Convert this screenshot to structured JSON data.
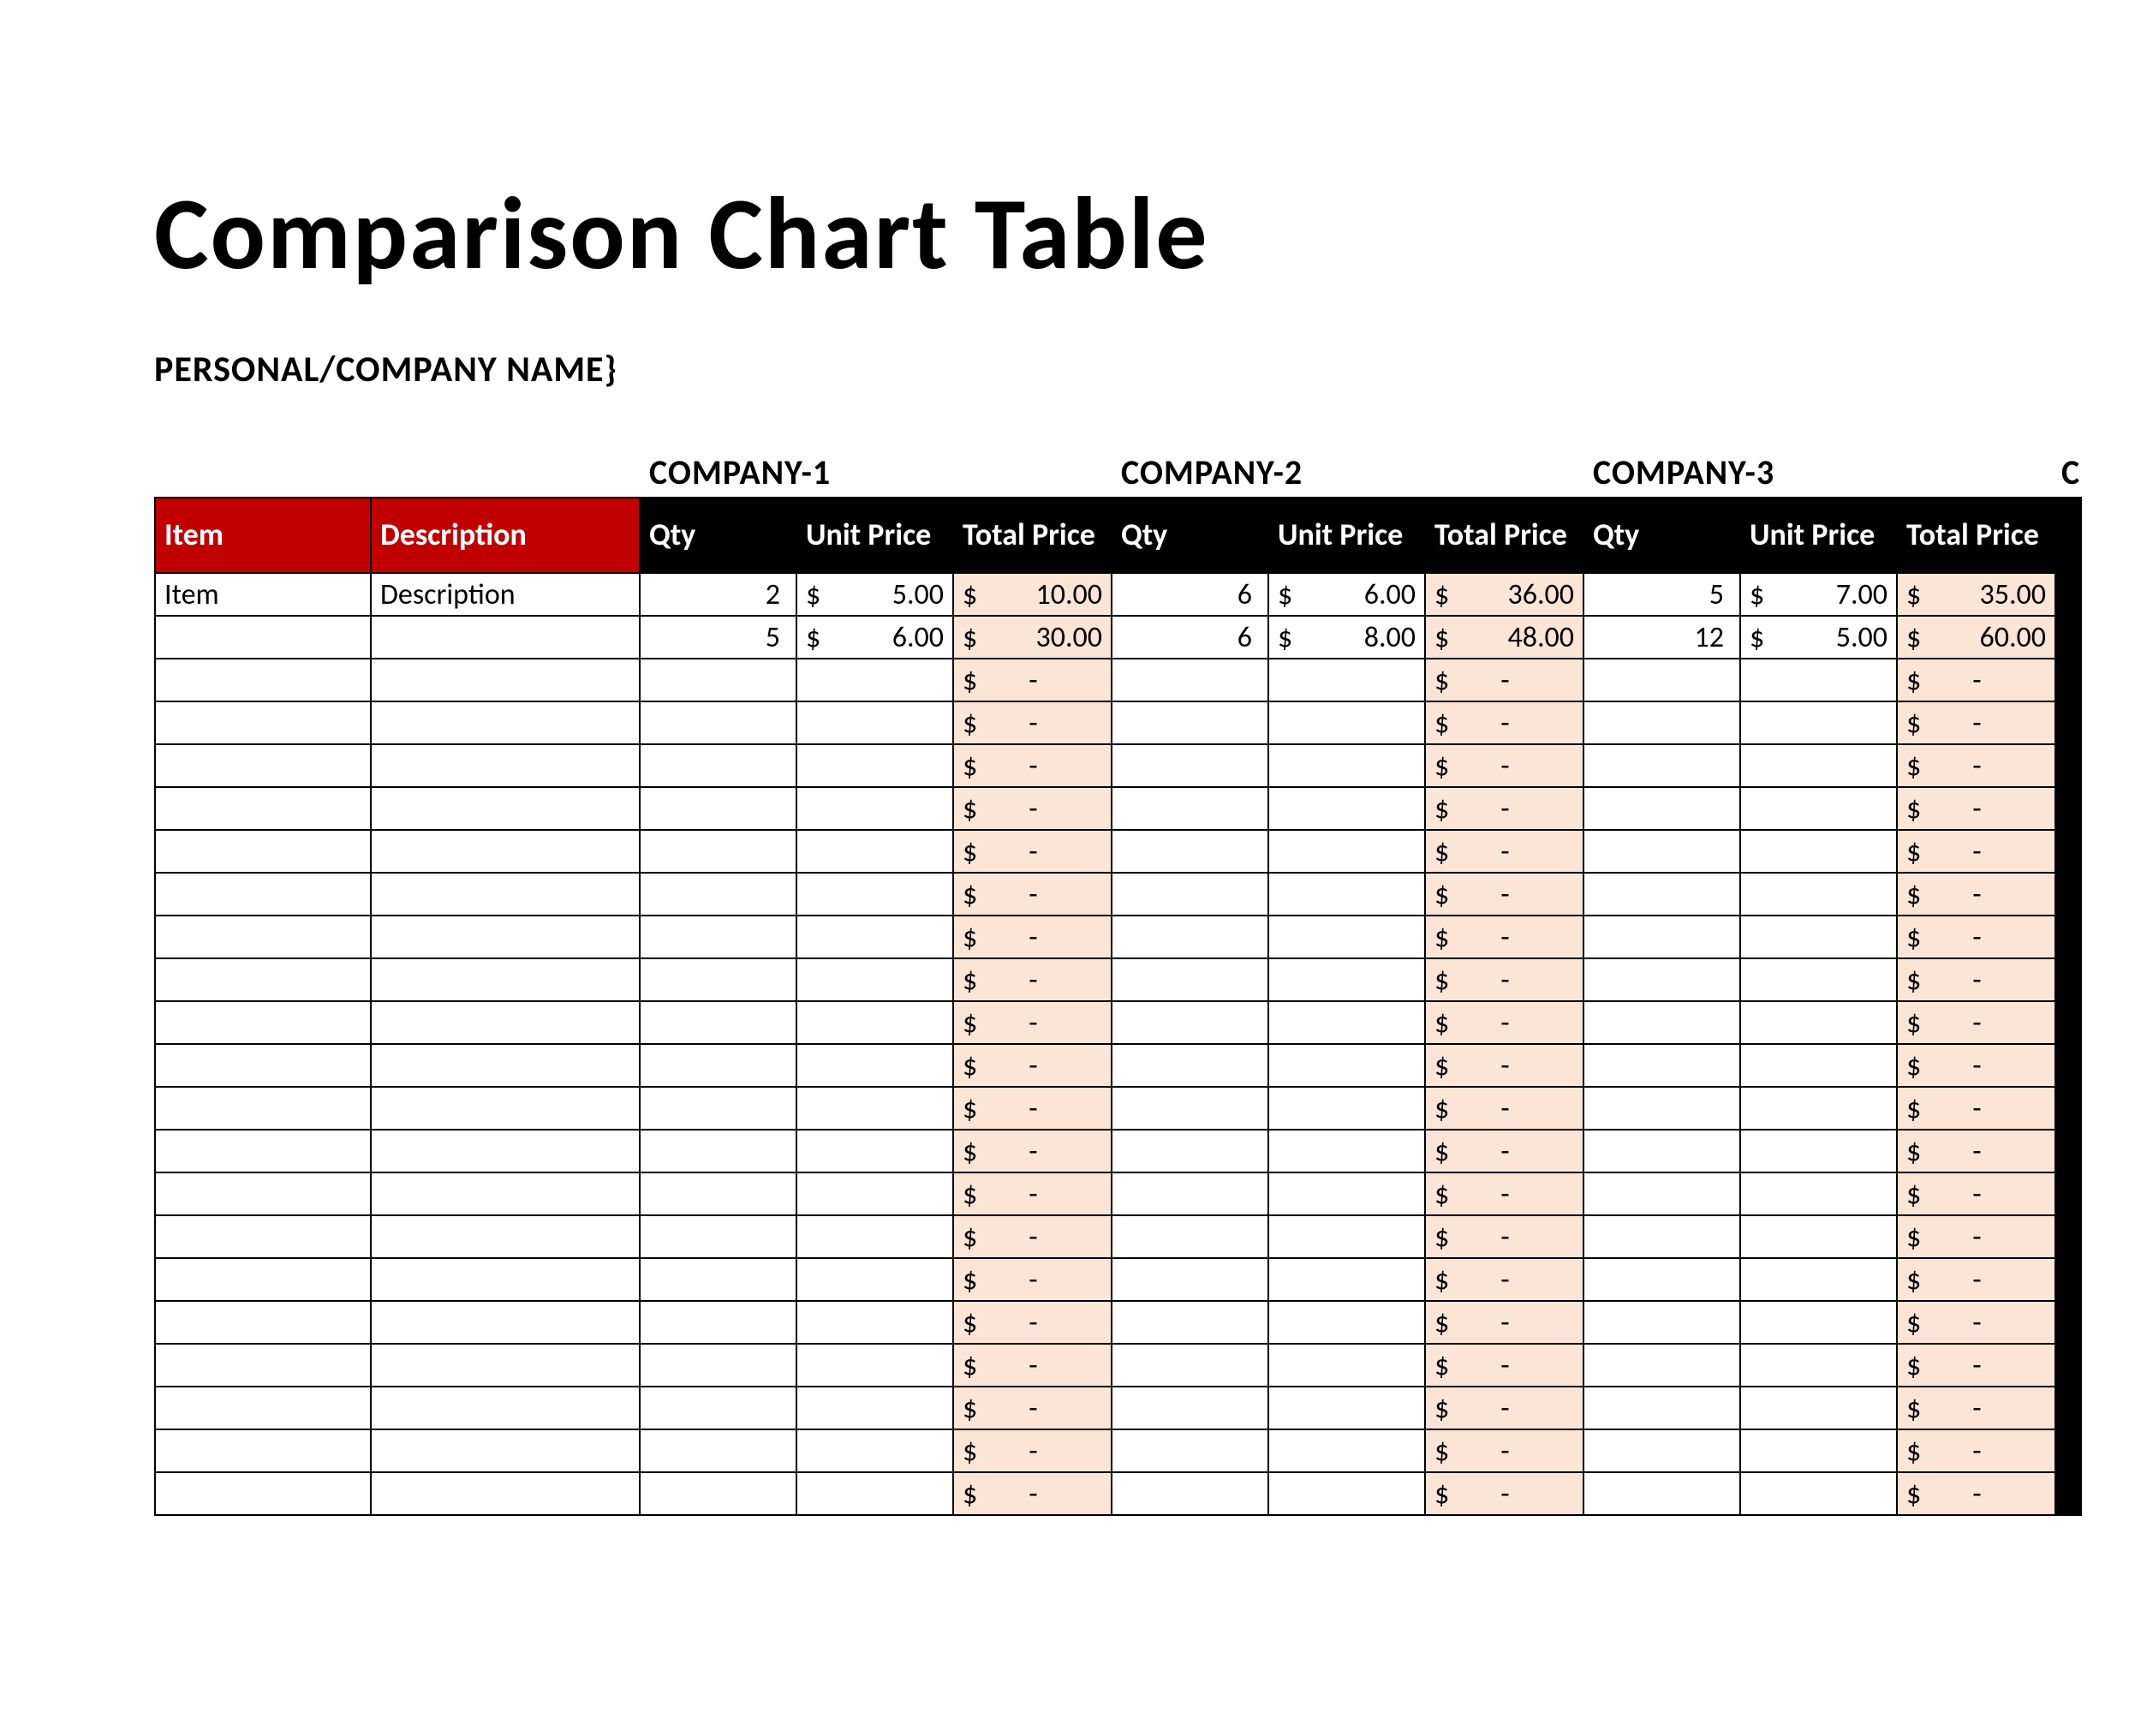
{
  "title": "Comparison Chart Table",
  "subtitle": "PERSONAL/COMPANY NAME}",
  "currency_symbol": "$",
  "dash": "-",
  "companies": [
    "COMPANY-1",
    "COMPANY-2",
    "COMPANY-3"
  ],
  "partial_company_letter": "C",
  "headers": {
    "item": "Item",
    "description": "Description",
    "qty": "Qty",
    "unit_price": "Unit Price",
    "total_price": "Total Price"
  },
  "rows": [
    {
      "item": "Item",
      "description": "Description",
      "c1": {
        "qty": "2",
        "unit": "5.00",
        "total": "10.00"
      },
      "c2": {
        "qty": "6",
        "unit": "6.00",
        "total": "36.00"
      },
      "c3": {
        "qty": "5",
        "unit": "7.00",
        "total": "35.00"
      }
    },
    {
      "item": "",
      "description": "",
      "c1": {
        "qty": "5",
        "unit": "6.00",
        "total": "30.00"
      },
      "c2": {
        "qty": "6",
        "unit": "8.00",
        "total": "48.00"
      },
      "c3": {
        "qty": "12",
        "unit": "5.00",
        "total": "60.00"
      }
    }
  ],
  "empty_row_count": 20,
  "chart_data": {
    "type": "table",
    "title": "Comparison Chart Table",
    "columns": [
      "Item",
      "Description",
      "Company-1 Qty",
      "Company-1 Unit Price",
      "Company-1 Total Price",
      "Company-2 Qty",
      "Company-2 Unit Price",
      "Company-2 Total Price",
      "Company-3 Qty",
      "Company-3 Unit Price",
      "Company-3 Total Price"
    ],
    "rows": [
      [
        "Item",
        "Description",
        2,
        5.0,
        10.0,
        6,
        6.0,
        36.0,
        5,
        7.0,
        35.0
      ],
      [
        "",
        "",
        5,
        6.0,
        30.0,
        6,
        8.0,
        48.0,
        12,
        5.0,
        60.0
      ]
    ]
  }
}
